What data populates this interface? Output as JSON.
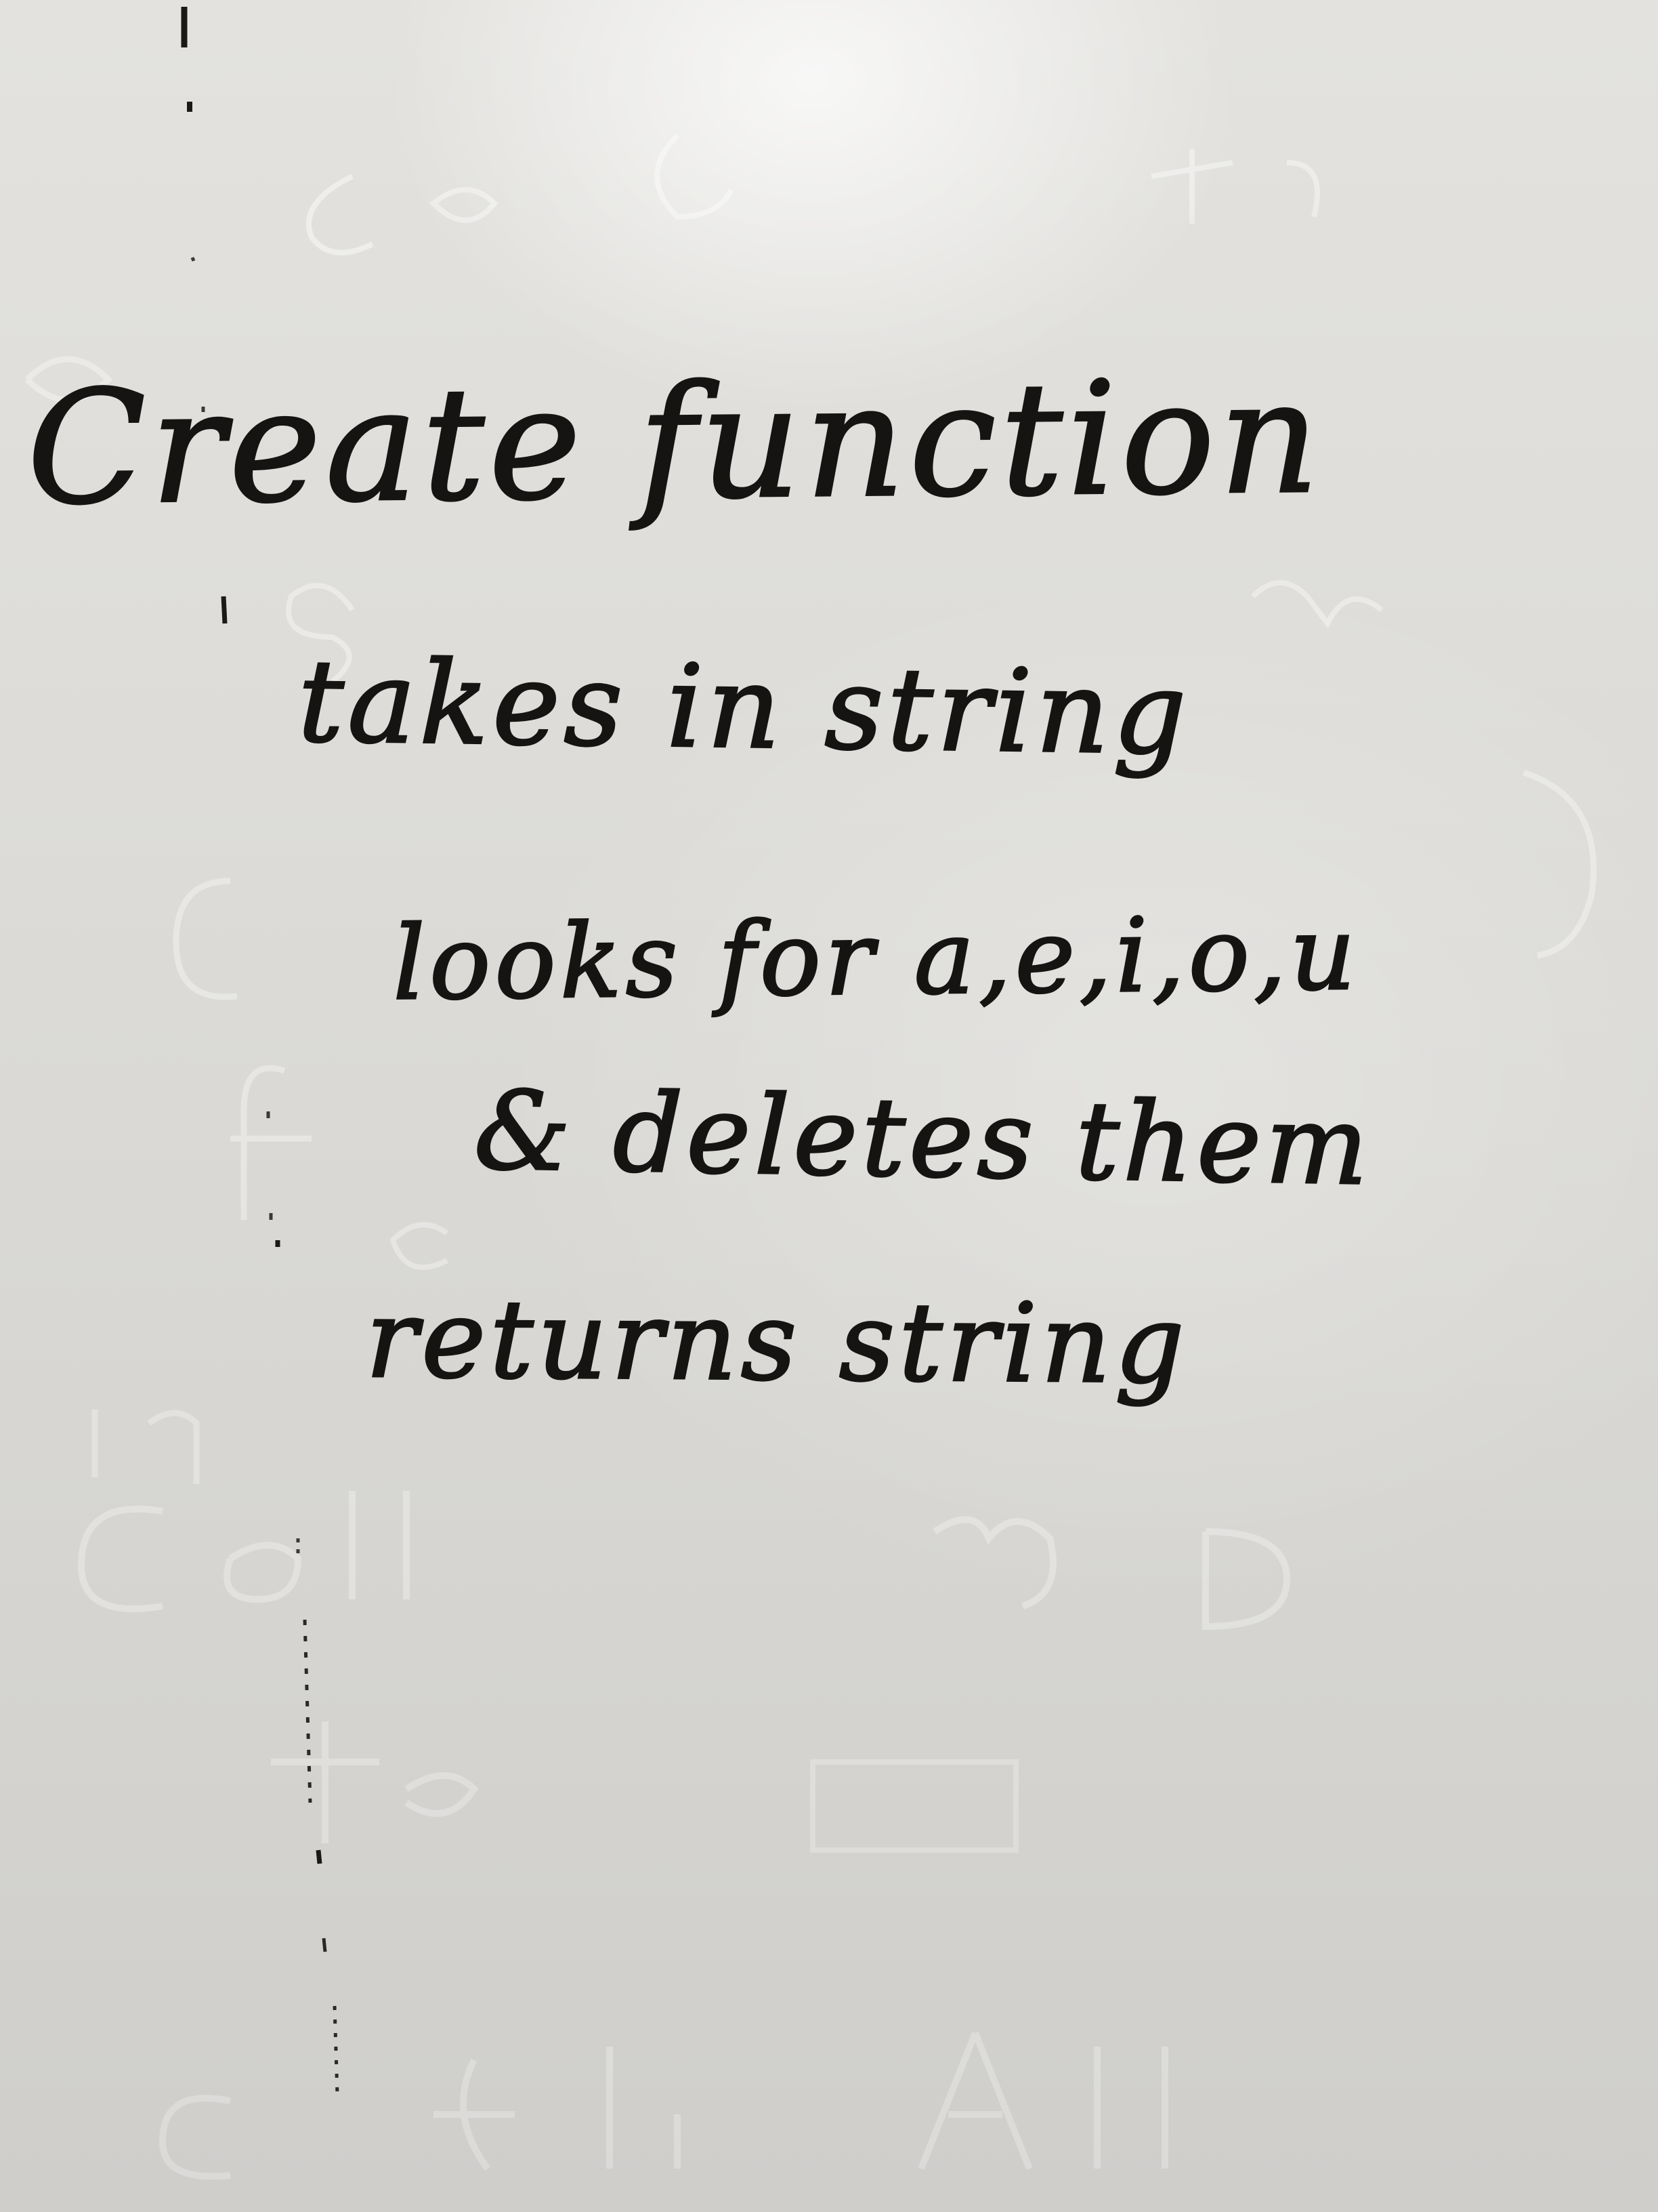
{
  "whiteboard": {
    "lines": [
      "Create function",
      "takes in string",
      "looks for a,e,i,o,u",
      "& deletes them",
      "returns string"
    ],
    "ghost_writing_color": "#ffffff",
    "ink_color": "#151413",
    "board_color": "#dcdbd8"
  }
}
